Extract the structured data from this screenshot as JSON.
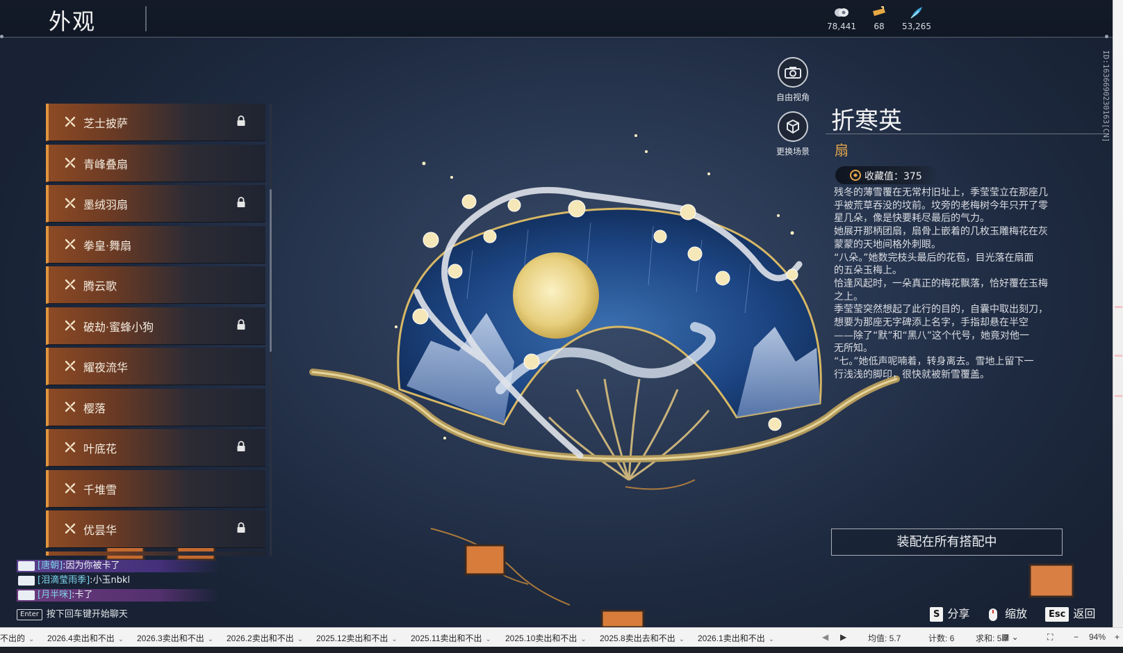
{
  "header": {
    "title": "外观"
  },
  "currencies": [
    {
      "icon": "gem-currency-icon",
      "value": "78,441"
    },
    {
      "icon": "ticket-currency-icon",
      "value": "68"
    },
    {
      "icon": "feather-currency-icon",
      "value": "53,265"
    }
  ],
  "skin_list": {
    "items": [
      {
        "label": "芝士披萨",
        "locked": true
      },
      {
        "label": "青峰叠扇",
        "locked": false
      },
      {
        "label": "墨绒羽扇",
        "locked": true
      },
      {
        "label": "拳皇·舞扇",
        "locked": false
      },
      {
        "label": "腾云歌",
        "locked": false
      },
      {
        "label": "破劫·蜜蜂小狗",
        "locked": true
      },
      {
        "label": "耀夜流华",
        "locked": false
      },
      {
        "label": "樱落",
        "locked": false
      },
      {
        "label": "叶底花",
        "locked": true
      },
      {
        "label": "千堆雪",
        "locked": false
      },
      {
        "label": "优昙华",
        "locked": true
      }
    ]
  },
  "camera": {
    "free_view_label": "自由视角",
    "change_scene_label": "更换场景"
  },
  "detail": {
    "name": "折寒英",
    "type": "扇",
    "collect_value": "收藏值：375",
    "description": "残冬的薄雪覆在无常村旧址上，季莹莹立在那座几\n乎被荒草吞没的坟前。坟旁的老梅树今年只开了零\n星几朵，像是快要耗尽最后的气力。\n她展开那柄团扇，扇骨上嵌着的几枚玉雕梅花在灰\n蒙蒙的天地间格外刺眼。\n“八朵。”她数完枝头最后的花苞，目光落在扇面\n的五朵玉梅上。\n恰逢风起时，一朵真正的梅花飘落，恰好覆在玉梅\n之上。\n季莹莹突然想起了此行的目的，自囊中取出刻刀，\n想要为那座无字碑添上名字，手指却悬在半空\n——除了“默”和“黑八”这个代号，她竟对他一\n无所知。\n“七。”她低声呢喃着，转身离去。雪地上留下一\n行浅浅的脚印，很快就被新雪覆盖。",
    "equip_button": "装配在所有搭配中",
    "vertical_id": "ID:1636690230163[CN]"
  },
  "chat": {
    "lines": [
      {
        "channel": "[唐朝]",
        "text": ":因为你被卡了"
      },
      {
        "channel": "[泪滴莹雨季]",
        "text": ":小玉nbkl"
      },
      {
        "channel": "[月半咪]",
        "text": ":卡了"
      }
    ],
    "enter_key": "Enter",
    "hint": "按下回车键开始聊天"
  },
  "hotkeys": {
    "share_key": "S",
    "share_label": "分享",
    "zoom_label": "缩放",
    "back_key": "Esc",
    "back_label": "返回"
  },
  "statusbar": {
    "tabs": [
      "不出的",
      "2026.4卖出和不出",
      "2026.3卖出和不出",
      "2026.2卖出和不出",
      "2025.12卖出和不出",
      "2025.11卖出和不出",
      "2025.10卖出和不出",
      "2025.8卖出去和不出",
      "2026.1卖出和不出"
    ],
    "average": "均值: 5.7",
    "count": "计数: 6",
    "sum": "求和: 5.7",
    "zoom": "94%"
  },
  "colors": {
    "accent_orange": "#e0953d",
    "type_gold": "#e4a64b",
    "chat_channel": "#7fd3ea"
  }
}
